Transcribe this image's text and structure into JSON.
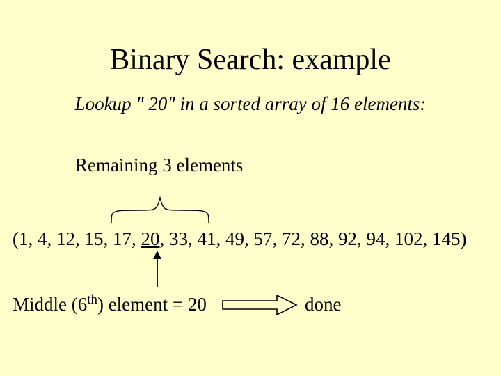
{
  "title": "Binary Search: example",
  "subtitle": "Lookup \" 20\" in a sorted array of 16 elements:",
  "remaining_label": "Remaining 3 elements",
  "array": {
    "open": "(",
    "close": ")",
    "sep": ", ",
    "elements": [
      "1",
      "4",
      "12",
      "15",
      "17",
      "20",
      "33",
      "41",
      "49",
      "57",
      "72",
      "88",
      "92",
      "94",
      "102",
      "145"
    ],
    "underlined_index": 5,
    "bracket_start_index": 4,
    "bracket_end_index": 6
  },
  "middle": {
    "prefix": "Middle (6",
    "super": "th",
    "suffix": ") element = 20"
  },
  "done_label": "done"
}
